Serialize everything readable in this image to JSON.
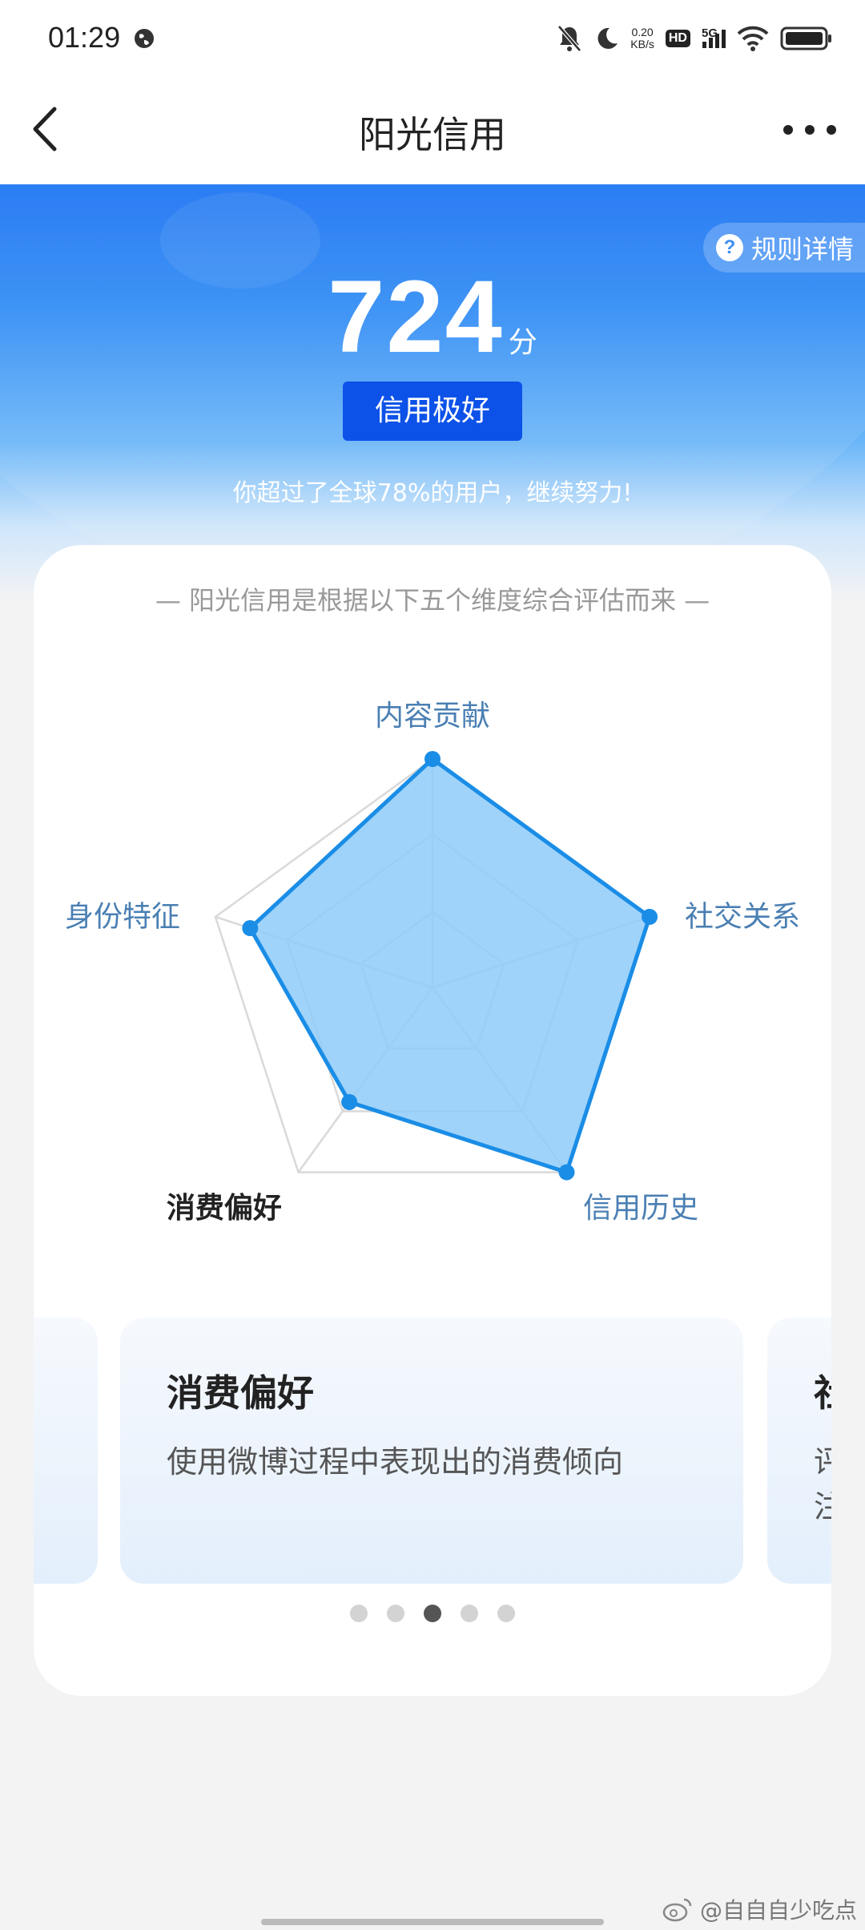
{
  "status_bar": {
    "time": "01:29",
    "net_speed_value": "0.20",
    "net_speed_unit": "KB/s",
    "hd": "HD",
    "network": "5G"
  },
  "nav": {
    "title": "阳光信用"
  },
  "hero": {
    "rules_label": "规则详情",
    "score": "724",
    "score_unit": "分",
    "level": "信用极好",
    "subtitle": "你超过了全球78%的用户，继续努力!"
  },
  "card": {
    "caption": "— 阳光信用是根据以下五个维度综合评估而来 —"
  },
  "chart_data": {
    "type": "radar",
    "categories": [
      "内容贡献",
      "社交关系",
      "信用历史",
      "消费偏好",
      "身份特征"
    ],
    "values": [
      1.0,
      1.0,
      1.0,
      0.62,
      0.84
    ],
    "active_category": "消费偏好",
    "grid_levels": [
      0.33,
      0.67,
      1.0
    ],
    "fill_color": "#8ecbf9",
    "line_color": "#1a8de6"
  },
  "carousel": {
    "slides": [
      {
        "title": "",
        "desc": ""
      },
      {
        "title": "消费偏好",
        "desc": "使用微博过程中表现出的消费倾向"
      },
      {
        "title": "社交关系",
        "desc_line1": "评",
        "desc_line2": "注"
      }
    ],
    "dot_count": 5,
    "active_index": 2
  },
  "watermark": {
    "text": "@自自自少吃点"
  },
  "colors": {
    "brand_blue": "#1a72f2",
    "badge_blue": "#0d52e8",
    "label_blue": "#4a7fb3"
  }
}
